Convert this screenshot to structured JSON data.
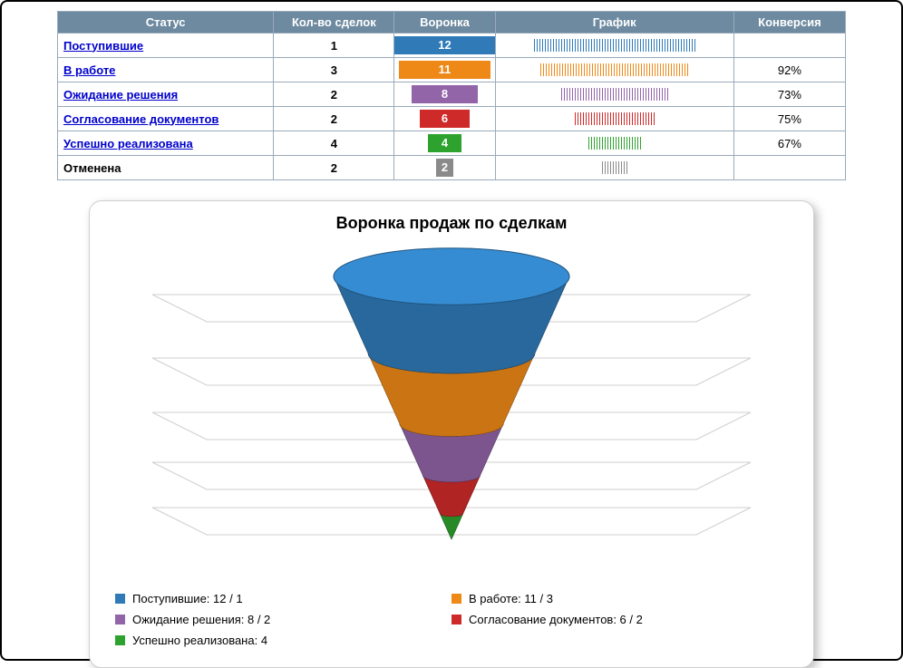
{
  "table": {
    "headers": {
      "status": "Статус",
      "count": "Кол-во сделок",
      "funnel": "Воронка",
      "chart": "График",
      "conversion": "Конверсия"
    }
  },
  "colors": {
    "blue": "#2f7ab7",
    "orange": "#ee8817",
    "purple": "#9264a8",
    "red": "#cf2a2a",
    "green": "#2ea22e",
    "gray": "#8a8a8a"
  },
  "stages": [
    {
      "id": "incoming",
      "label": "Поступившие",
      "count": 1,
      "funnel": 12,
      "conversion": "",
      "colorKey": "blue",
      "link": true
    },
    {
      "id": "inwork",
      "label": "В работе",
      "count": 3,
      "funnel": 11,
      "conversion": "92%",
      "colorKey": "orange",
      "link": true
    },
    {
      "id": "waiting",
      "label": "Ожидание решения",
      "count": 2,
      "funnel": 8,
      "conversion": "73%",
      "colorKey": "purple",
      "link": true
    },
    {
      "id": "docs",
      "label": "Согласование документов",
      "count": 2,
      "funnel": 6,
      "conversion": "75%",
      "colorKey": "red",
      "link": true
    },
    {
      "id": "success",
      "label": "Успешно реализована",
      "count": 4,
      "funnel": 4,
      "conversion": "67%",
      "colorKey": "green",
      "link": true
    },
    {
      "id": "cancelled",
      "label": "Отменена",
      "count": 2,
      "funnel": 2,
      "conversion": "",
      "colorKey": "gray",
      "link": false
    }
  ],
  "chart": {
    "title": "Воронка продаж по сделкам",
    "legend": [
      {
        "text": "Поступившие: 12 / 1",
        "colorKey": "blue"
      },
      {
        "text": "В работе: 11 / 3",
        "colorKey": "orange"
      },
      {
        "text": "Ожидание решения: 8 / 2",
        "colorKey": "purple"
      },
      {
        "text": "Согласование документов: 6 / 2",
        "colorKey": "red"
      },
      {
        "text": "Успешно реализована: 4",
        "colorKey": "green"
      }
    ]
  },
  "chart_data": {
    "type": "funnel",
    "title": "Воронка продаж по сделкам",
    "series": [
      {
        "name": "Поступившие",
        "value": 12,
        "count": 1,
        "color": "#2f7ab7"
      },
      {
        "name": "В работе",
        "value": 11,
        "count": 3,
        "color": "#ee8817"
      },
      {
        "name": "Ожидание решения",
        "value": 8,
        "count": 2,
        "color": "#9264a8"
      },
      {
        "name": "Согласование документов",
        "value": 6,
        "count": 2,
        "color": "#cf2a2a"
      },
      {
        "name": "Успешно реализована",
        "value": 4,
        "count": 4,
        "color": "#2ea22e"
      }
    ],
    "table_extra": [
      {
        "name": "Отменена",
        "value": 2,
        "count": 2,
        "color": "#8a8a8a"
      }
    ],
    "conversion_percent": [
      null,
      92,
      73,
      75,
      67,
      null
    ]
  }
}
